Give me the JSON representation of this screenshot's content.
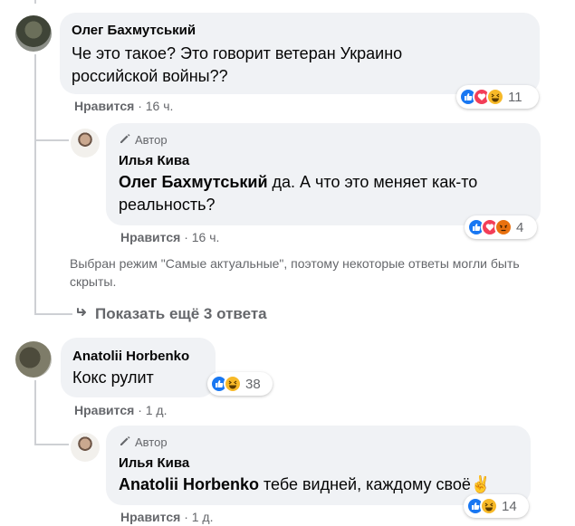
{
  "comments": [
    {
      "author": "Олег Бахмутський",
      "lines": [
        "Че это такое? Это говорит ветеран Украино",
        "российской войны??"
      ],
      "like_label": "Нравится",
      "separator": "·",
      "time": "16 ч.",
      "reactions": [
        "like-icon",
        "love-icon",
        "haha-icon"
      ],
      "reaction_count": "11"
    },
    {
      "author_badge": "Автор",
      "author": "Илья Кива",
      "mention": "Олег Бахмутський",
      "line1_rest": " да. А что это меняет как-то",
      "line2": "реальность?",
      "like_label": "Нравится",
      "separator": "·",
      "time": "16 ч.",
      "reactions": [
        "like-icon",
        "love-icon",
        "angry-icon"
      ],
      "reaction_count": "4"
    },
    {
      "author": "Anatolii Horbenko",
      "text": "Кокс рулит",
      "like_label": "Нравится",
      "separator": "·",
      "time": "1 д.",
      "reactions": [
        "like-icon",
        "haha-icon"
      ],
      "reaction_count": "38"
    },
    {
      "author_badge": "Автор",
      "author": "Илья Кива",
      "mention": "Anatolii Horbenko",
      "rest": " тебе видней, каждому своё",
      "emoji": "✌",
      "like_label": "Нравится",
      "separator": "·",
      "time": "1 д.",
      "reactions": [
        "like-icon",
        "haha-icon"
      ],
      "reaction_count": "14"
    }
  ],
  "notice": {
    "line1": "Выбран режим \"Самые актуальные\", поэтому некоторые ответы могли быть",
    "line2": "скрыты."
  },
  "show_more": "Показать ещё 3 ответа",
  "colors": {
    "bubble": "#f0f2f5",
    "meta_text": "#65676b",
    "like_blue": "#1877f2",
    "love_red": "#f33e58",
    "haha_yellow": "#f7b928",
    "angry_orange": "#e9710f"
  }
}
